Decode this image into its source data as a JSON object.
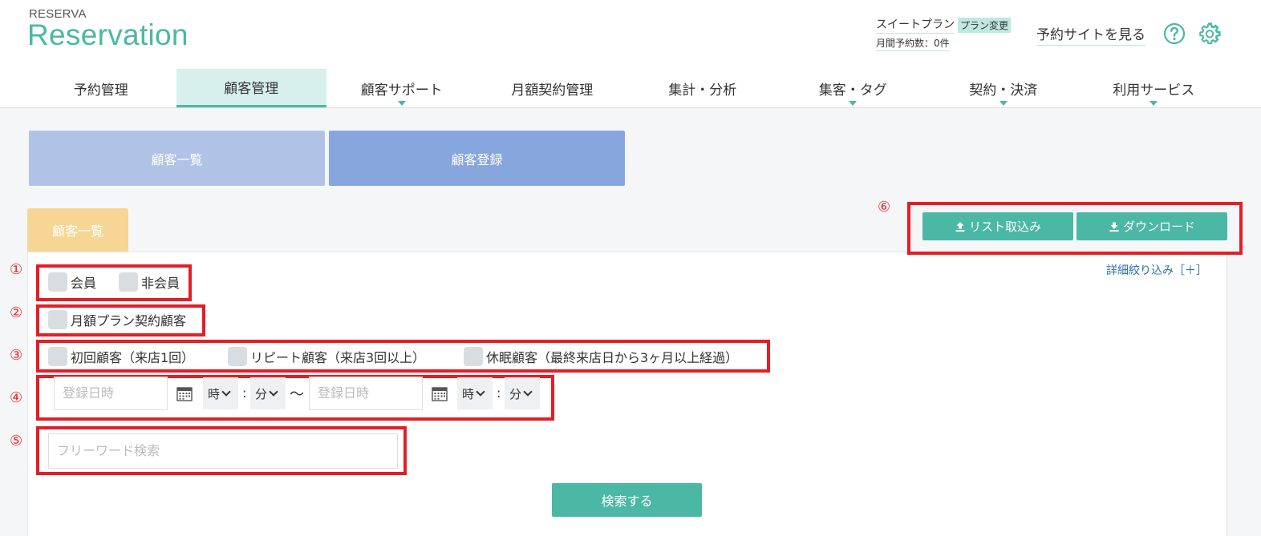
{
  "header": {
    "logo_small": "RESERVA",
    "logo_big": "Reservation",
    "plan_name": "スイートプラン",
    "plan_change": "プラン変更",
    "monthly_reservations": "月間予約数：0件",
    "view_site": "予約サイトを見る"
  },
  "nav": {
    "items": [
      {
        "label": "予約管理",
        "active": false,
        "caret": false
      },
      {
        "label": "顧客管理",
        "active": true,
        "caret": false
      },
      {
        "label": "顧客サポート",
        "active": false,
        "caret": true
      },
      {
        "label": "月額契約管理",
        "active": false,
        "caret": false
      },
      {
        "label": "集計・分析",
        "active": false,
        "caret": false
      },
      {
        "label": "集客・タグ",
        "active": false,
        "caret": true
      },
      {
        "label": "契約・決済",
        "active": false,
        "caret": true
      },
      {
        "label": "利用サービス",
        "active": false,
        "caret": true
      }
    ]
  },
  "top_buttons": {
    "customer_list": "顧客一覧",
    "customer_register": "顧客登録"
  },
  "tab": {
    "label": "顧客一覧"
  },
  "annotations": [
    "①",
    "②",
    "③",
    "④",
    "⑤",
    "⑥"
  ],
  "filters": {
    "member": "会員",
    "non_member": "非会員",
    "monthly_plan": "月額プラン契約顧客",
    "first_visit": "初回顧客（来店1回）",
    "repeat": "リピート顧客（来店3回以上）",
    "dormant": "休眠顧客（最終来店日から3ヶ月以上経過）",
    "date_placeholder": "登録日時",
    "hour": "時",
    "minute": "分",
    "colon": ":",
    "tilde": "〜",
    "free_word_placeholder": "フリーワード検索"
  },
  "actions": {
    "import": "リスト取込み",
    "download": "ダウンロード",
    "detail_filter": "詳細絞り込み［＋］",
    "search": "検索する"
  },
  "colors": {
    "brand": "#4ab8a4",
    "annotation_red": "#e41e26"
  }
}
